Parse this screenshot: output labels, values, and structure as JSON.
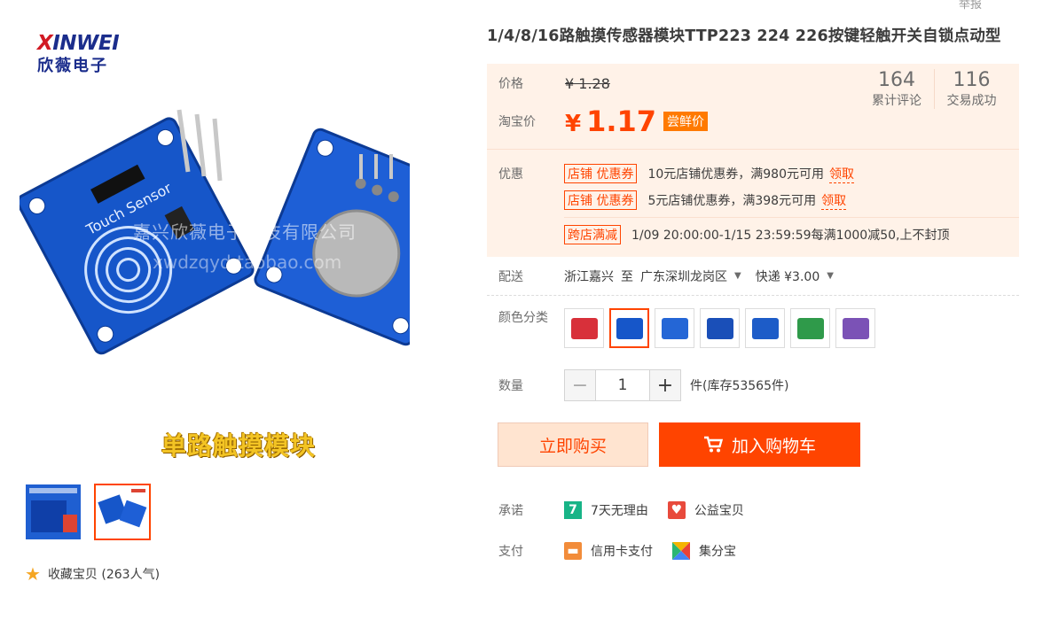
{
  "logo": {
    "en_prefix": "X",
    "en_rest": "INWEI",
    "cn": "欣薇电子"
  },
  "gallery": {
    "watermark": "嘉兴欣薇电子科技有限公司",
    "watermark_url": "xwdzqyd.taobao.com",
    "caption": "单路触摸模块",
    "favorite": "收藏宝贝 (263人气)"
  },
  "report": "举报",
  "title": "1/4/8/16路触摸传感器模块TTP223 224 226按键轻触开关自锁点动型",
  "price": {
    "label": "价格",
    "original": "¥ 1.28",
    "taobao_label": "淘宝价",
    "yen": "¥",
    "current": "1.17",
    "tag": "尝鲜价"
  },
  "stats": [
    {
      "num": "164",
      "label": "累计评论"
    },
    {
      "num": "116",
      "label": "交易成功"
    }
  ],
  "promo": {
    "label": "优惠",
    "coupons": [
      {
        "tag": "店铺 优惠券",
        "text": "10元店铺优惠券，满980元可用",
        "link": "领取"
      },
      {
        "tag": "店铺 优惠券",
        "text": "5元店铺优惠券，满398元可用",
        "link": "领取"
      }
    ],
    "cross": {
      "tag": "跨店满减",
      "text": "1/09 20:00:00-1/15 23:59:59每满1000减50,上不封顶"
    }
  },
  "shipping": {
    "label": "配送",
    "from": "浙江嘉兴",
    "to_word": "至",
    "dest": "广东深圳龙岗区",
    "method": "快递 ¥3.00"
  },
  "sku": {
    "label": "颜色分类"
  },
  "quantity": {
    "label": "数量",
    "value": "1",
    "minus": "−",
    "plus": "+",
    "stock": "件(库存53565件)"
  },
  "actions": {
    "buy": "立即购买",
    "cart": "加入购物车"
  },
  "promise": {
    "label": "承诺",
    "items": [
      "7天无理由",
      "公益宝贝"
    ],
    "seven": "7"
  },
  "payment": {
    "label": "支付",
    "items": [
      "信用卡支付",
      "集分宝"
    ]
  },
  "colors": {
    "accent": "#ff4400",
    "price_bg": "#fff2e8"
  }
}
